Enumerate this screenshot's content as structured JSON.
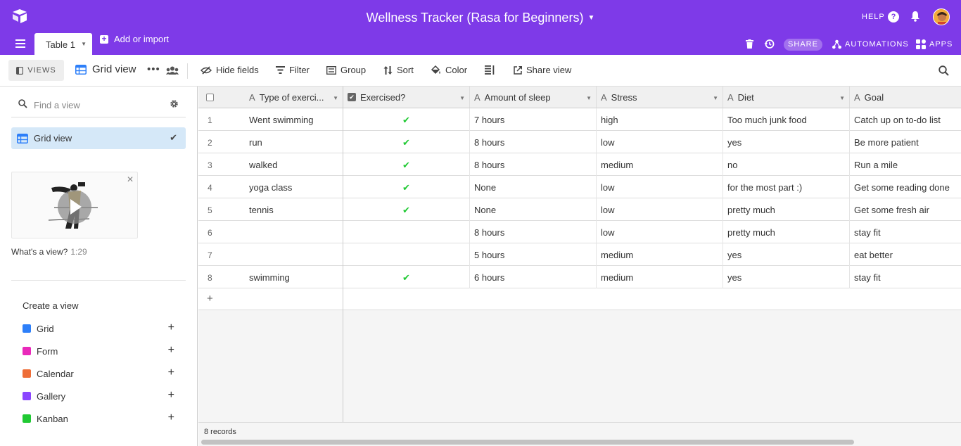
{
  "app": {
    "base_title": "Wellness Tracker (Rasa for Beginners)",
    "help_label": "HELP",
    "share_label": "SHARE",
    "automations_label": "AUTOMATIONS",
    "apps_label": "APPS",
    "accent_color": "#7e3ae8"
  },
  "tabs": {
    "table_label": "Table 1",
    "add_import_label": "Add or import"
  },
  "viewbar": {
    "views_label": "VIEWS",
    "current_view": "Grid view",
    "hide_fields": "Hide fields",
    "filter": "Filter",
    "group": "Group",
    "sort": "Sort",
    "color": "Color",
    "share_view": "Share view"
  },
  "sidebar": {
    "find_placeholder": "Find a view",
    "active_view": "Grid view",
    "video_caption": "What's a view?",
    "video_duration": "1:29",
    "create_title": "Create a view",
    "create_items": [
      {
        "label": "Grid",
        "color": "#2d7ff9"
      },
      {
        "label": "Form",
        "color": "#e929ba"
      },
      {
        "label": "Calendar",
        "color": "#ee6d37"
      },
      {
        "label": "Gallery",
        "color": "#8b46ff"
      },
      {
        "label": "Kanban",
        "color": "#20c933"
      }
    ]
  },
  "grid": {
    "columns": [
      "Type of exerci...",
      "Exercised?",
      "Amount of sleep",
      "Stress",
      "Diet",
      "Goal"
    ],
    "rows": [
      {
        "num": "1",
        "type": "Went swimming",
        "exercised": "✔",
        "sleep": "7 hours",
        "stress": "high",
        "diet": "Too much junk food",
        "goal": "Catch up on to-do list"
      },
      {
        "num": "2",
        "type": "run",
        "exercised": "✔",
        "sleep": "8 hours",
        "stress": "low",
        "diet": "yes",
        "goal": "Be more patient"
      },
      {
        "num": "3",
        "type": "walked",
        "exercised": "✔",
        "sleep": "8 hours",
        "stress": "medium",
        "diet": "no",
        "goal": "Run a mile"
      },
      {
        "num": "4",
        "type": "yoga class",
        "exercised": "✔",
        "sleep": "None",
        "stress": "low",
        "diet": "for the most part :)",
        "goal": "Get some reading done"
      },
      {
        "num": "5",
        "type": "tennis",
        "exercised": "✔",
        "sleep": "None",
        "stress": "low",
        "diet": "pretty much",
        "goal": "Get some fresh air"
      },
      {
        "num": "6",
        "type": "",
        "exercised": "",
        "sleep": "8 hours",
        "stress": "low",
        "diet": "pretty much",
        "goal": "stay fit"
      },
      {
        "num": "7",
        "type": "",
        "exercised": "",
        "sleep": "5 hours",
        "stress": "medium",
        "diet": "yes",
        "goal": "eat better"
      },
      {
        "num": "8",
        "type": "swimming",
        "exercised": "✔",
        "sleep": "6 hours",
        "stress": "medium",
        "diet": "yes",
        "goal": "stay fit"
      }
    ],
    "add_row_symbol": "+",
    "record_count": "8 records"
  }
}
